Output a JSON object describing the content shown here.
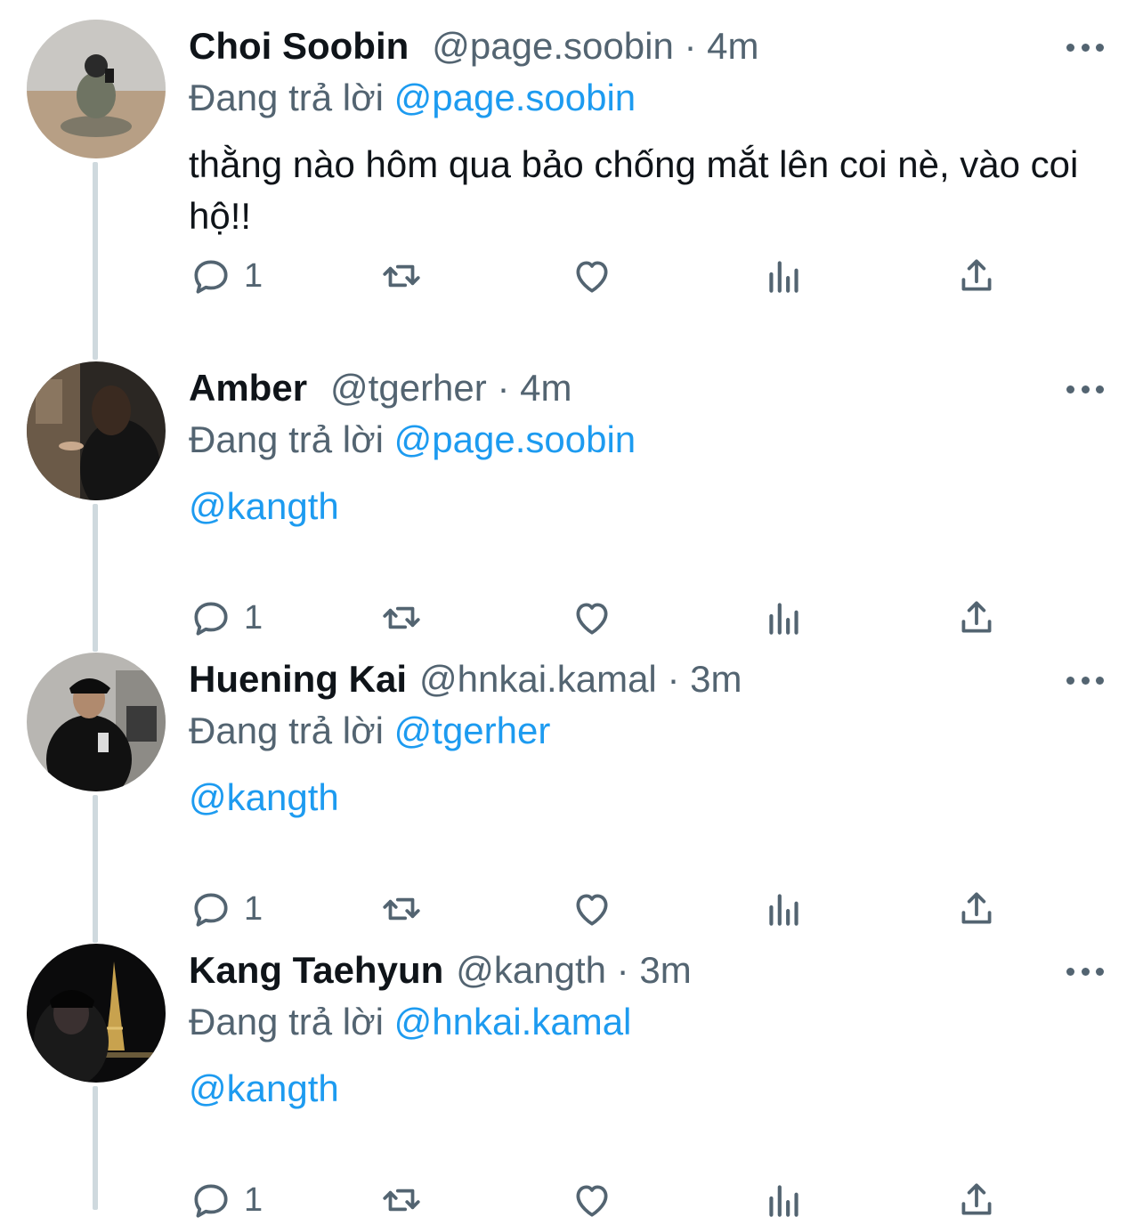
{
  "colors": {
    "accent": "#1d9bf0",
    "secondary_text": "#536471",
    "primary_text": "#0f1419",
    "thread_line": "#cfd9de"
  },
  "icons": {
    "reply": "reply-icon",
    "retweet": "retweet-icon",
    "like": "heart-icon",
    "views": "views-chart-icon",
    "share": "share-icon",
    "more": "more-icon"
  },
  "tweets": [
    {
      "name": "Choi Soobin",
      "handle": "@page.soobin",
      "separator": "·",
      "time": "4m",
      "reply_prefix": "Đang trả lời",
      "reply_to": "@page.soobin",
      "body_text": "thằng nào hôm qua bảo chống mắt lên coi nè, vào coi hộ!!",
      "body_mention": "",
      "reply_count": "1"
    },
    {
      "name": "Amber",
      "handle": "@tgerher",
      "separator": "·",
      "time": "4m",
      "reply_prefix": "Đang trả lời",
      "reply_to": "@page.soobin",
      "body_text": "",
      "body_mention": "@kangth",
      "reply_count": "1"
    },
    {
      "name": "Huening Kai",
      "handle": "@hnkai.kamal",
      "separator": "·",
      "time": "3m",
      "reply_prefix": "Đang trả lời",
      "reply_to": "@tgerher",
      "body_text": "",
      "body_mention": "@kangth",
      "reply_count": "1"
    },
    {
      "name": "Kang Taehyun",
      "handle": "@kangth",
      "separator": "·",
      "time": "3m",
      "reply_prefix": "Đang trả lời",
      "reply_to": "@hnkai.kamal",
      "body_text": "",
      "body_mention": "@kangth",
      "reply_count": "1"
    }
  ]
}
